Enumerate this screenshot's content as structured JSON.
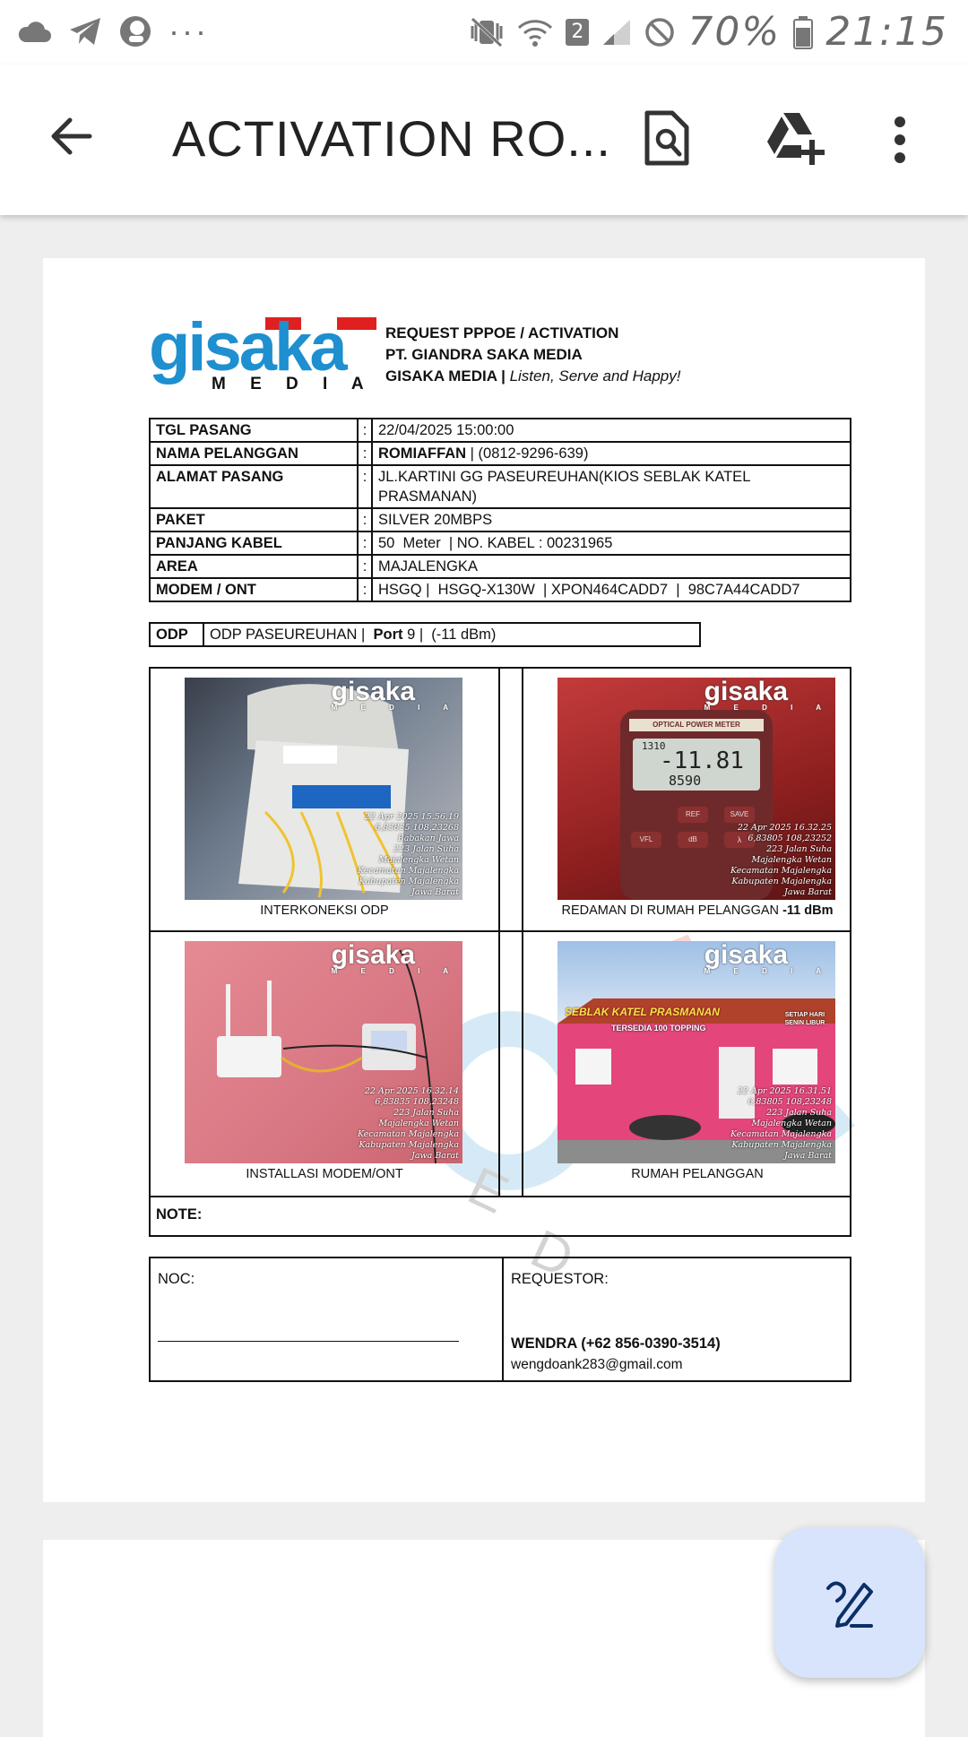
{
  "status_bar": {
    "left_icons": [
      "cloud-icon",
      "telegram-icon",
      "vpn-app-icon",
      "more-dots-icon"
    ],
    "more": "···",
    "sim_badge": "2",
    "battery_percent": "70%",
    "time": "21:15"
  },
  "toolbar": {
    "title": "ACTIVATION RO...",
    "icons": [
      "back-arrow-icon",
      "find-in-page-icon",
      "drive-add-icon",
      "more-vert-icon"
    ]
  },
  "document": {
    "logo": {
      "word": "gisaka",
      "sub": "M E D I A"
    },
    "header_line1": "REQUEST PPPOE / ACTIVATION",
    "header_line2": "PT. GIANDRA SAKA MEDIA",
    "header_line3_brand": "GISAKA MEDIA |",
    "header_line3_tagline": "Listen, Serve and Happy!",
    "colon": ":",
    "info": {
      "tgl_pasang": {
        "label": "TGL PASANG",
        "value": "22/04/2025 15:00:00"
      },
      "nama_pelanggan": {
        "label": "NAMA PELANGGAN",
        "value_bold": "ROMIAFFAN",
        "value": " | (0812-9296-639)"
      },
      "alamat_pasang": {
        "label": "ALAMAT PASANG",
        "value_line1": "JL.KARTINI GG PASEUREUHAN(KIOS SEBLAK KATEL",
        "value_line2": "PRASMANAN)"
      },
      "paket": {
        "label": "PAKET",
        "value": "SILVER 20MBPS"
      },
      "panjang_kabel": {
        "label": "PANJANG KABEL",
        "value": "50  Meter  | NO. KABEL : 00231965"
      },
      "area": {
        "label": "AREA",
        "value": "MAJALENGKA"
      },
      "modem_ont": {
        "label": "MODEM / ONT",
        "value": "HSGQ |  HSGQ-X130W  | XPON464CADD7  |  98C7A44CADD7"
      }
    },
    "odp": {
      "label": "ODP",
      "name": "ODP PASEUREUHAN |",
      "port_label": "Port",
      "port_value": "9 |  (-11 dBm)"
    },
    "photos": {
      "p1": {
        "caption": "INTERKONEKSI ODP",
        "stamp": [
          "22 Apr 2025 15.56.19",
          "6,83835 108,23268",
          "Babakan Jawa",
          "223 Jalan Suha",
          "Majalengka Wetan",
          "Kecamatan Majalengka",
          "Kabupaten Majalengka",
          "Jawa Barat"
        ]
      },
      "p2": {
        "caption": "REDAMAN DI RUMAH PELANGGAN",
        "caption_bold": "-11 dBm",
        "meter_title": "OPTICAL POWER METER",
        "meter_reading_top": "1310",
        "meter_reading_main": "-11.81",
        "meter_reading_sub": "8590",
        "meter_keys": [
          "REF",
          "SAVE",
          "λ",
          "dB",
          "VFL"
        ],
        "stamp": [
          "22 Apr 2025 16.32.25",
          "6,83805 108,23252",
          "223 Jalan Suha",
          "Majalengka Wetan",
          "Kecamatan Majalengka",
          "Kabupaten Majalengka",
          "Jawa Barat"
        ]
      },
      "p3": {
        "caption": "INSTALLASI MODEM/ONT",
        "stamp": [
          "22 Apr 2025 16.32.14",
          "6,83835 108,23248",
          "223 Jalan Suha",
          "Majalengka Wetan",
          "Kecamatan Majalengka",
          "Kabupaten Majalengka",
          "Jawa Barat"
        ]
      },
      "p4": {
        "caption": "RUMAH PELANGGAN",
        "sign_main": "SEBLAK KATEL PRASMANAN",
        "sign_sub": "TERSEDIA 100 TOPPING",
        "sign_right": "SETIAP HARI SENIN LIBUR",
        "stamp": [
          "22 Apr 2025 16.31.51",
          "6,83805 108,23248",
          "223 Jalan Suha",
          "Majalengka Wetan",
          "Kecamatan Majalengka",
          "Kabupaten Majalengka",
          "Jawa Barat"
        ]
      }
    },
    "note_label": "NOTE:",
    "noc_label": "NOC:",
    "noc_line": "_______________________________________",
    "requestor_label": "REQUESTOR:",
    "requestor_name": "WENDRA (+62 856-0390-3514)",
    "requestor_email": "wengdoank283@gmail.com",
    "watermark_letters": [
      "E",
      "D"
    ]
  },
  "colors": {
    "logo_blue": "#1e8fcf",
    "logo_red": "#e02020",
    "fab_bg": "#d8e4fb",
    "fab_icon": "#0b2f66"
  },
  "fab": {
    "icon": "edit-pen-icon"
  }
}
